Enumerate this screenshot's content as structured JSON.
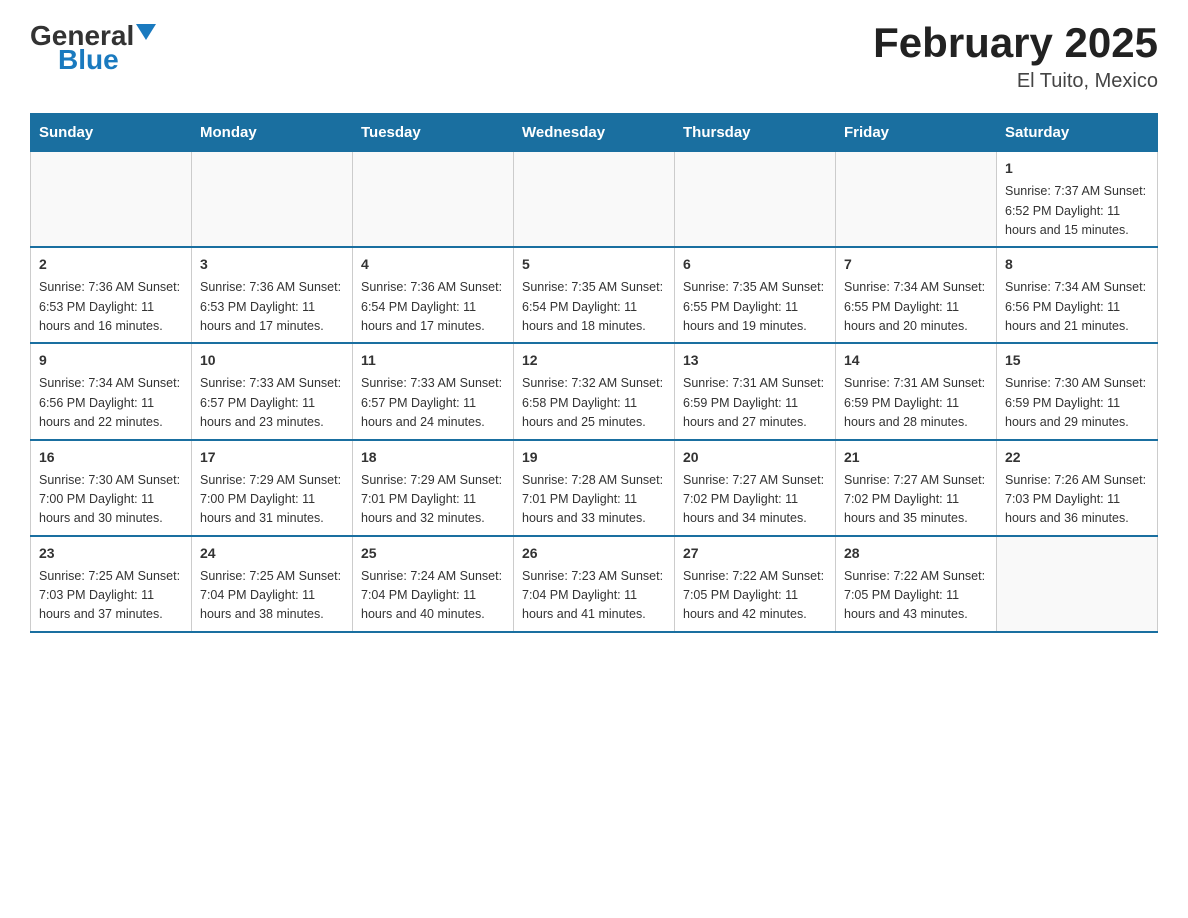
{
  "header": {
    "logo_general": "General",
    "logo_blue": "Blue",
    "title": "February 2025",
    "subtitle": "El Tuito, Mexico"
  },
  "days_of_week": [
    "Sunday",
    "Monday",
    "Tuesday",
    "Wednesday",
    "Thursday",
    "Friday",
    "Saturday"
  ],
  "weeks": [
    [
      {
        "day": "",
        "info": ""
      },
      {
        "day": "",
        "info": ""
      },
      {
        "day": "",
        "info": ""
      },
      {
        "day": "",
        "info": ""
      },
      {
        "day": "",
        "info": ""
      },
      {
        "day": "",
        "info": ""
      },
      {
        "day": "1",
        "info": "Sunrise: 7:37 AM\nSunset: 6:52 PM\nDaylight: 11 hours and 15 minutes."
      }
    ],
    [
      {
        "day": "2",
        "info": "Sunrise: 7:36 AM\nSunset: 6:53 PM\nDaylight: 11 hours and 16 minutes."
      },
      {
        "day": "3",
        "info": "Sunrise: 7:36 AM\nSunset: 6:53 PM\nDaylight: 11 hours and 17 minutes."
      },
      {
        "day": "4",
        "info": "Sunrise: 7:36 AM\nSunset: 6:54 PM\nDaylight: 11 hours and 17 minutes."
      },
      {
        "day": "5",
        "info": "Sunrise: 7:35 AM\nSunset: 6:54 PM\nDaylight: 11 hours and 18 minutes."
      },
      {
        "day": "6",
        "info": "Sunrise: 7:35 AM\nSunset: 6:55 PM\nDaylight: 11 hours and 19 minutes."
      },
      {
        "day": "7",
        "info": "Sunrise: 7:34 AM\nSunset: 6:55 PM\nDaylight: 11 hours and 20 minutes."
      },
      {
        "day": "8",
        "info": "Sunrise: 7:34 AM\nSunset: 6:56 PM\nDaylight: 11 hours and 21 minutes."
      }
    ],
    [
      {
        "day": "9",
        "info": "Sunrise: 7:34 AM\nSunset: 6:56 PM\nDaylight: 11 hours and 22 minutes."
      },
      {
        "day": "10",
        "info": "Sunrise: 7:33 AM\nSunset: 6:57 PM\nDaylight: 11 hours and 23 minutes."
      },
      {
        "day": "11",
        "info": "Sunrise: 7:33 AM\nSunset: 6:57 PM\nDaylight: 11 hours and 24 minutes."
      },
      {
        "day": "12",
        "info": "Sunrise: 7:32 AM\nSunset: 6:58 PM\nDaylight: 11 hours and 25 minutes."
      },
      {
        "day": "13",
        "info": "Sunrise: 7:31 AM\nSunset: 6:59 PM\nDaylight: 11 hours and 27 minutes."
      },
      {
        "day": "14",
        "info": "Sunrise: 7:31 AM\nSunset: 6:59 PM\nDaylight: 11 hours and 28 minutes."
      },
      {
        "day": "15",
        "info": "Sunrise: 7:30 AM\nSunset: 6:59 PM\nDaylight: 11 hours and 29 minutes."
      }
    ],
    [
      {
        "day": "16",
        "info": "Sunrise: 7:30 AM\nSunset: 7:00 PM\nDaylight: 11 hours and 30 minutes."
      },
      {
        "day": "17",
        "info": "Sunrise: 7:29 AM\nSunset: 7:00 PM\nDaylight: 11 hours and 31 minutes."
      },
      {
        "day": "18",
        "info": "Sunrise: 7:29 AM\nSunset: 7:01 PM\nDaylight: 11 hours and 32 minutes."
      },
      {
        "day": "19",
        "info": "Sunrise: 7:28 AM\nSunset: 7:01 PM\nDaylight: 11 hours and 33 minutes."
      },
      {
        "day": "20",
        "info": "Sunrise: 7:27 AM\nSunset: 7:02 PM\nDaylight: 11 hours and 34 minutes."
      },
      {
        "day": "21",
        "info": "Sunrise: 7:27 AM\nSunset: 7:02 PM\nDaylight: 11 hours and 35 minutes."
      },
      {
        "day": "22",
        "info": "Sunrise: 7:26 AM\nSunset: 7:03 PM\nDaylight: 11 hours and 36 minutes."
      }
    ],
    [
      {
        "day": "23",
        "info": "Sunrise: 7:25 AM\nSunset: 7:03 PM\nDaylight: 11 hours and 37 minutes."
      },
      {
        "day": "24",
        "info": "Sunrise: 7:25 AM\nSunset: 7:04 PM\nDaylight: 11 hours and 38 minutes."
      },
      {
        "day": "25",
        "info": "Sunrise: 7:24 AM\nSunset: 7:04 PM\nDaylight: 11 hours and 40 minutes."
      },
      {
        "day": "26",
        "info": "Sunrise: 7:23 AM\nSunset: 7:04 PM\nDaylight: 11 hours and 41 minutes."
      },
      {
        "day": "27",
        "info": "Sunrise: 7:22 AM\nSunset: 7:05 PM\nDaylight: 11 hours and 42 minutes."
      },
      {
        "day": "28",
        "info": "Sunrise: 7:22 AM\nSunset: 7:05 PM\nDaylight: 11 hours and 43 minutes."
      },
      {
        "day": "",
        "info": ""
      }
    ]
  ]
}
